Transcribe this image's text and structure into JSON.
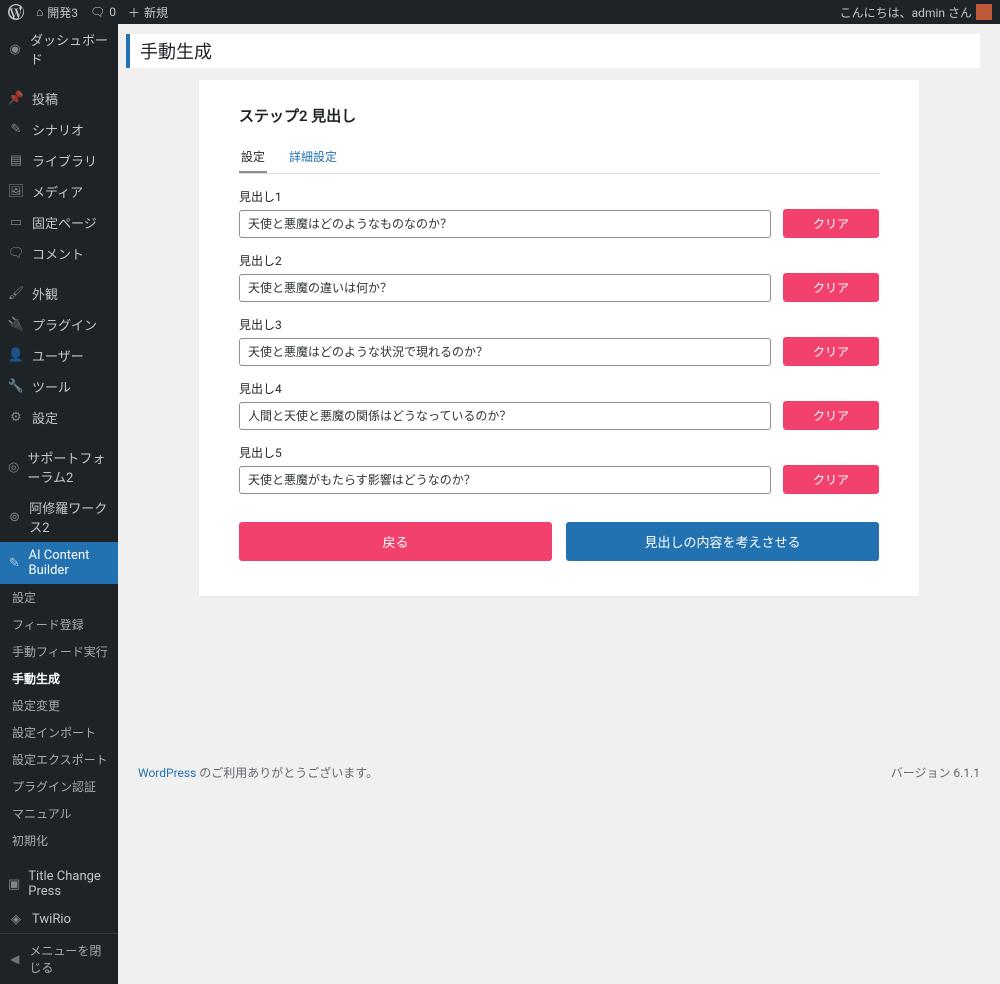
{
  "adminbar": {
    "site_name": "開発3",
    "comments_count": "0",
    "new_label": "新規",
    "greeting": "こんにちは、admin さん"
  },
  "sidebar": {
    "dashboard": "ダッシュボード",
    "posts": "投稿",
    "scenario": "シナリオ",
    "library": "ライブラリ",
    "media": "メディア",
    "pages": "固定ページ",
    "comments": "コメント",
    "appearance": "外観",
    "plugins": "プラグイン",
    "users": "ユーザー",
    "tools": "ツール",
    "settings": "設定",
    "support_forum": "サポートフォーラム2",
    "ashura_works": "阿修羅ワークス2",
    "ai_builder": "AI Content Builder",
    "title_change": "Title Change Press",
    "twirio": "TwiRio",
    "collapse": "メニューを閉じる",
    "sub": {
      "settings": "設定",
      "feed_register": "フィード登録",
      "feed_manual": "手動フィード実行",
      "manual_gen": "手動生成",
      "setting_change": "設定変更",
      "setting_import": "設定インポート",
      "setting_export": "設定エクスポート",
      "plugin_auth": "プラグイン認証",
      "manual": "マニュアル",
      "init": "初期化"
    }
  },
  "page": {
    "title": "手動生成",
    "step_title": "ステップ2 見出し",
    "tabs": {
      "config": "設定",
      "adv": "詳細設定"
    },
    "fields": [
      {
        "label": "見出し1",
        "value": "天使と悪魔はどのようなものなのか？"
      },
      {
        "label": "見出し2",
        "value": "天使と悪魔の違いは何か？"
      },
      {
        "label": "見出し3",
        "value": "天使と悪魔はどのような状況で現れるのか？"
      },
      {
        "label": "見出し4",
        "value": "人間と天使と悪魔の関係はどうなっているのか？"
      },
      {
        "label": "見出し5",
        "value": "天使と悪魔がもたらす影響はどうなのか？"
      }
    ],
    "clear_label": "クリア",
    "back_label": "戻る",
    "submit_label": "見出しの内容を考えさせる"
  },
  "footer": {
    "thanks_link": "WordPress",
    "thanks_text": " のご利用ありがとうございます。",
    "version": "バージョン 6.1.1"
  }
}
